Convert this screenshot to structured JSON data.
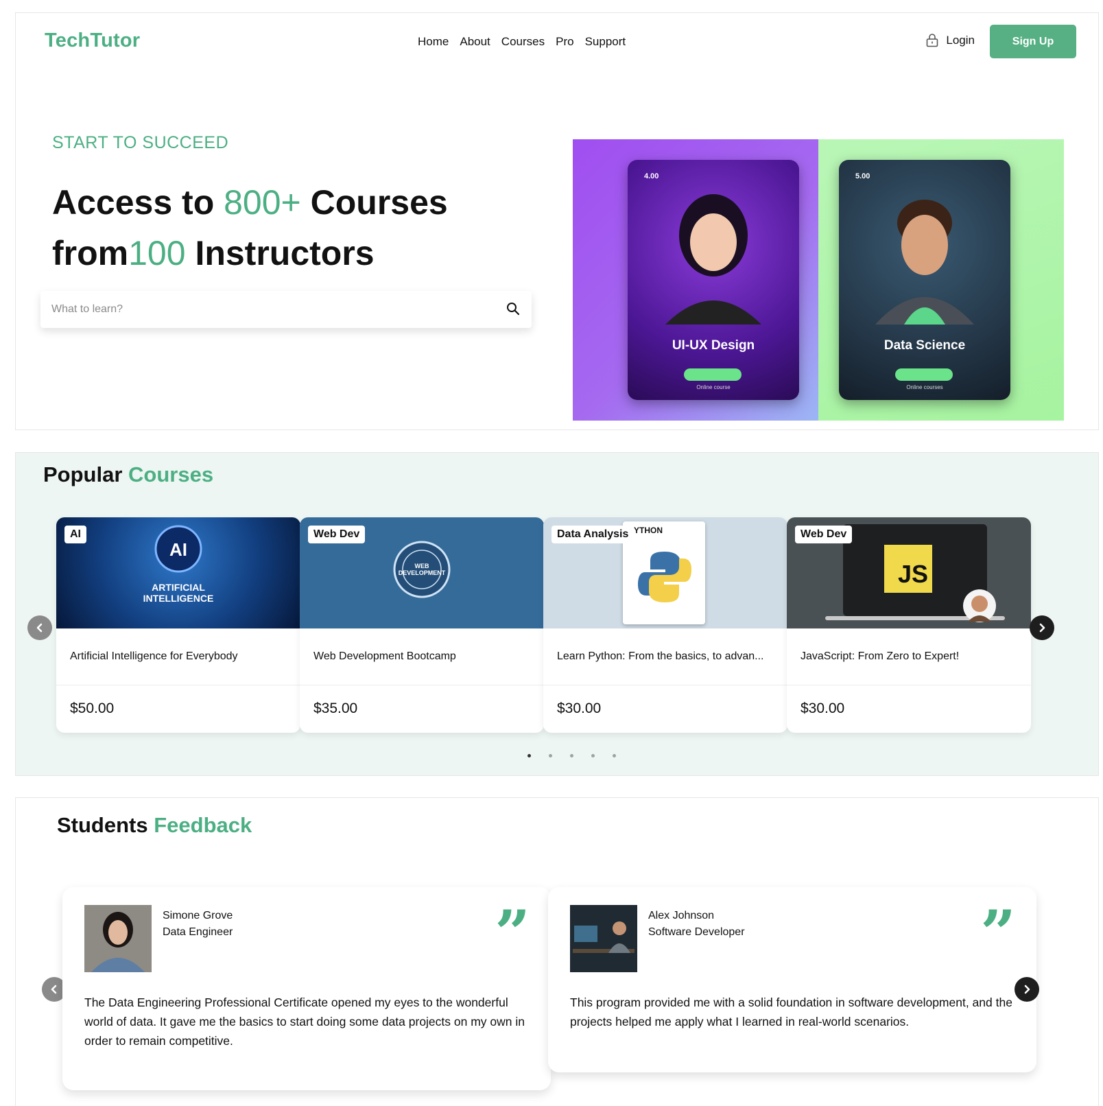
{
  "nav": {
    "brand": "TechTutor",
    "links": [
      "Home",
      "About",
      "Courses",
      "Pro",
      "Support"
    ],
    "login": "Login",
    "signup": "Sign Up"
  },
  "hero": {
    "eyebrow": "START TO SUCCEED",
    "title_part1": "Access to ",
    "title_highlight1": "800+",
    "title_part2": " Courses",
    "title_part3": "from",
    "title_highlight2": "100",
    "title_part4": " Instructors",
    "search_placeholder": "What to learn?",
    "cards": [
      {
        "rating": "4.00",
        "title": "UI-UX Design",
        "sub": "Online course"
      },
      {
        "rating": "5.00",
        "title": "Data Science",
        "sub": "Online courses"
      }
    ]
  },
  "popular": {
    "title": "Popular",
    "title_highlight": "Courses",
    "courses": [
      {
        "tag": "AI",
        "name": "Artificial Intelligence for Everybody",
        "price": "$50.00",
        "thumb_text": "ARTIFICIAL INTELLIGENCE"
      },
      {
        "tag": "Web Dev",
        "name": "Web Development Bootcamp",
        "price": "$35.00",
        "thumb_text": "WEB DEVELOPMENT"
      },
      {
        "tag": "Data Analysis",
        "name": "Learn Python: From the basics, to advan...",
        "price": "$30.00",
        "thumb_text": "YTHON"
      },
      {
        "tag": "Web Dev",
        "name": "JavaScript: From Zero to Expert!",
        "price": "$30.00",
        "thumb_text": "JS"
      }
    ],
    "page_count": 5,
    "active_page": 1
  },
  "feedback": {
    "title": "Students",
    "title_highlight": "Feedback",
    "items": [
      {
        "name": "Simone Grove",
        "role": "Data Engineer",
        "text": "The Data Engineering Professional Certificate opened my eyes to the wonderful world of data. It gave me the basics to start doing some data projects on my own in order to remain competitive."
      },
      {
        "name": "Alex Johnson",
        "role": "Software Developer",
        "text": "This program provided me with a solid foundation in software development, and the projects helped me apply what I learned in real-world scenarios."
      }
    ]
  },
  "colors": {
    "accent": "#4caf83",
    "section_bg": "#eef6f3"
  }
}
